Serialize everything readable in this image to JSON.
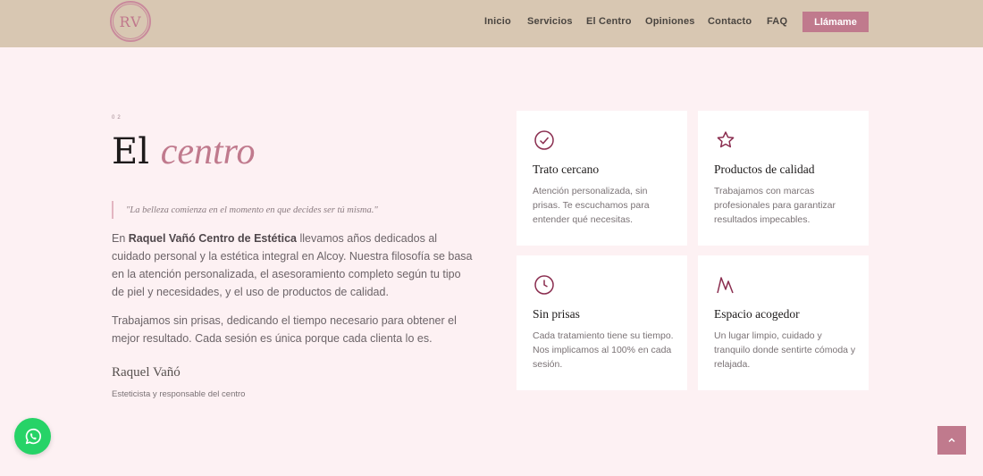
{
  "header": {
    "logo_text": "RV",
    "nav": [
      "Inicio",
      "Servicios",
      "El Centro",
      "Opiniones",
      "Contacto",
      "FAQ"
    ],
    "cta_label": "Llámame"
  },
  "about": {
    "section_number": "02",
    "title_plain": "El",
    "title_accent": "centro",
    "quote": "\"La belleza comienza en el momento en que decides ser tú misma.\"",
    "para1_prefix": "En ",
    "para1_bold": "Raquel Vañó Centro de Estética",
    "para1_rest": " llevamos años dedicados al cuidado personal y la estética integral en Alcoy. Nuestra filosofía se basa en la atención personalizada, el asesoramiento completo según tu tipo de piel y necesidades, y el uso de productos de calidad.",
    "para2": "Trabajamos sin prisas, dedicando el tiempo necesario para obtener el mejor resultado. Cada sesión es única porque cada clienta lo es.",
    "signature_name": "Raquel Vañó",
    "signature_role": "Esteticista y responsable del centro"
  },
  "cards": [
    {
      "icon": "check-circle-icon",
      "title": "Trato cercano",
      "text": "Atención personalizada, sin prisas. Te escuchamos para entender qué necesitas."
    },
    {
      "icon": "star-icon",
      "title": "Productos de calidad",
      "text": "Trabajamos con marcas profesionales para garantizar resultados impecables."
    },
    {
      "icon": "clock-icon",
      "title": "Sin prisas",
      "text": "Cada tratamiento tiene su tiempo. Nos implicamos al 100% en cada sesión."
    },
    {
      "icon": "mountain-icon",
      "title": "Espacio acogedor",
      "text": "Un lugar limpio, cuidado y tranquilo donde sentirte cómoda y relajada."
    }
  ],
  "floating": {
    "whatsapp_icon": "whatsapp-icon",
    "to_top_icon": "chevron-up-icon"
  },
  "colors": {
    "header_bg": "#d8c7b2",
    "page_bg": "#fdf1f3",
    "accent": "#c07a8d",
    "icon": "#8a2d4f",
    "whatsapp": "#26d367"
  }
}
